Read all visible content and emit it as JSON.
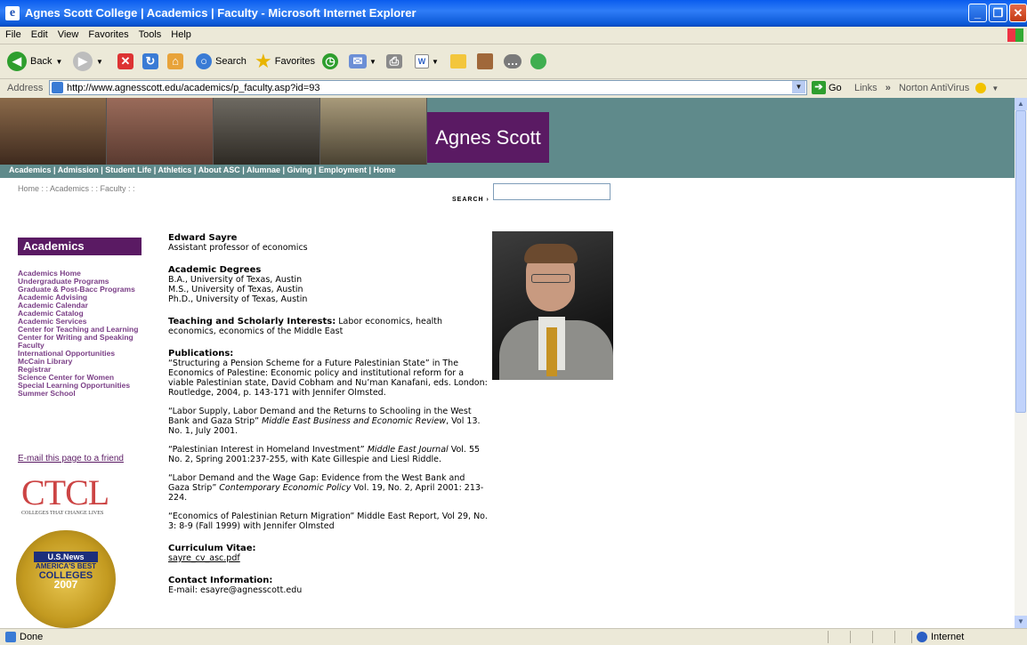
{
  "window": {
    "title": "Agnes Scott College | Academics | Faculty - Microsoft Internet Explorer"
  },
  "menu": [
    "File",
    "Edit",
    "View",
    "Favorites",
    "Tools",
    "Help"
  ],
  "toolbar": {
    "back": "Back",
    "search": "Search",
    "favorites": "Favorites"
  },
  "address": {
    "label": "Address",
    "url": "http://www.agnesscott.edu/academics/p_faculty.asp?id=93",
    "go": "Go",
    "links": "Links",
    "norton": "Norton AntiVirus"
  },
  "site": {
    "brand": "Agnes Scott",
    "topnav": "Academics | Admission | Student Life | Athletics | About ASC | Alumnae | Giving | Employment | Home",
    "breadcrumb": "Home : : Academics : : Faculty : :",
    "search_label": "SEARCH ›"
  },
  "sidebar": {
    "heading": "Academics",
    "items": [
      "Academics Home",
      "Undergraduate Programs",
      "Graduate & Post-Bacc Programs",
      "Academic Advising",
      "Academic Calendar",
      "Academic Catalog",
      "Academic Services",
      "Center for Teaching and Learning",
      "Center for Writing and Speaking",
      "Faculty",
      "International Opportunities",
      "McCain Library",
      "Registrar",
      "Science Center for Women",
      "Special Learning Opportunities",
      "Summer School"
    ],
    "email_link": "E-mail this page to a friend",
    "ctcl": {
      "logo": "CTCL",
      "tagline": "COLLEGES THAT CHANGE LIVES"
    },
    "usnews": {
      "brand": "U.S.News",
      "line1": "AMERICA'S BEST",
      "line2": "COLLEGES",
      "year": "2007"
    }
  },
  "profile": {
    "name": "Edward Sayre",
    "title": "Assistant professor of economics",
    "degrees_heading": "Academic Degrees",
    "degrees": [
      "B.A., University of Texas, Austin",
      "M.S., University of Texas, Austin",
      "Ph.D., University of Texas, Austin"
    ],
    "interests_heading": "Teaching and Scholarly Interests:",
    "interests": "Labor economics, health economics, economics of the Middle East",
    "pubs_heading": "Publications:",
    "pubs": [
      {
        "pre": "“Structuring a Pension Scheme for a Future Palestinian State” in The Economics of Palestine: Economic policy and institutional reform for a viable Palestinian state, David Cobham and Nu’man Kanafani, eds. London: Routledge, 2004, p. 143-171 with Jennifer Olmsted.",
        "em": "",
        "post": ""
      },
      {
        "pre": "“Labor Supply, Labor Demand and the Returns to Schooling in the West Bank and Gaza Strip” ",
        "em": "Middle East Business and Economic Review",
        "post": ", Vol 13. No. 1, July 2001."
      },
      {
        "pre": "“Palestinian Interest in Homeland Investment” ",
        "em": "Middle East Journal",
        "post": " Vol. 55 No. 2, Spring 2001:237-255, with Kate Gillespie and Liesl Riddle."
      },
      {
        "pre": "“Labor Demand and the Wage Gap: Evidence from the West Bank and Gaza Strip” ",
        "em": "Contemporary Economic Policy",
        "post": " Vol. 19, No. 2, April 2001: 213-224."
      },
      {
        "pre": "“Economics of Palestinian Return Migration” Middle East Report, Vol 29, No. 3: 8-9 (Fall 1999) with Jennifer Olmsted",
        "em": "",
        "post": ""
      }
    ],
    "cv_heading": "Curriculum Vitae:",
    "cv_file": "sayre_cv_asc.pdf",
    "contact_heading": "Contact Information:",
    "contact_email": "E-mail: esayre@agnesscott.edu"
  },
  "status": {
    "text": "Done",
    "zone": "Internet"
  }
}
